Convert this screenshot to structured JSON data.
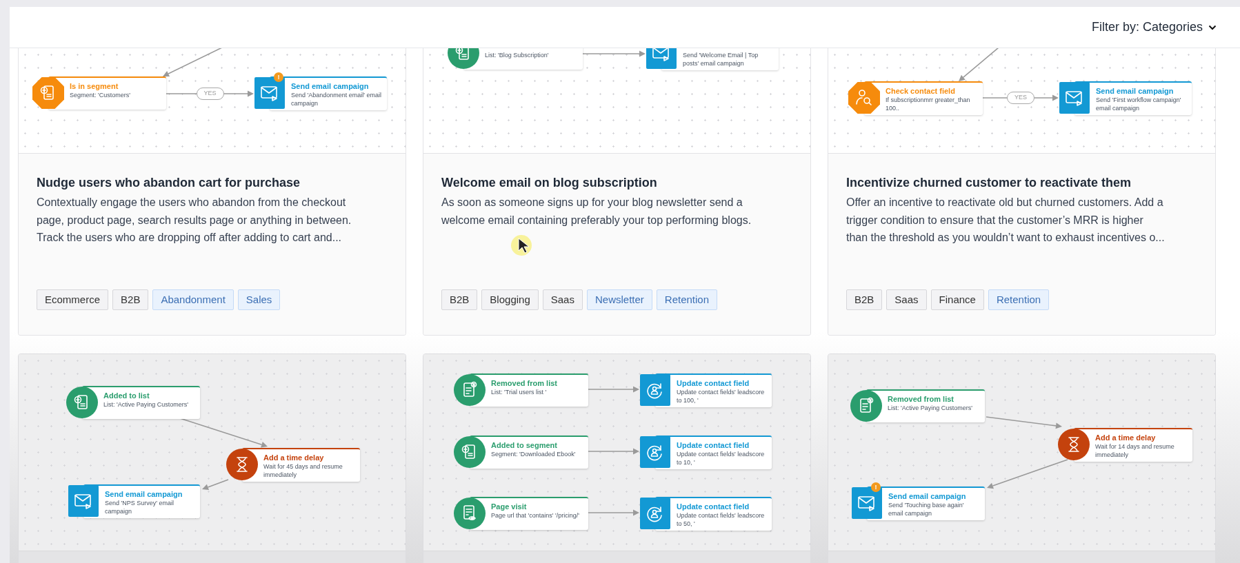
{
  "filter": {
    "label": "Filter by: Categories"
  },
  "templates": [
    {
      "nodes": [
        {
          "kind": "in_segment",
          "title": "Is in segment",
          "description": "Segment: 'Customers'"
        },
        {
          "kind": "send_email",
          "title": "Send email campaign",
          "description": "Send 'Abandonment email' email campaign",
          "badge": "!",
          "branch_label": "YES"
        }
      ],
      "title": "Nudge users who abandon cart for purchase",
      "description": [
        "Contextually engage the users who abandon from the checkout",
        "page, product page, search results page or anything in between.",
        "Track the users who are dropping off after adding to cart and..."
      ],
      "tags": [
        {
          "label": "Ecommerce",
          "kind": "plain"
        },
        {
          "label": "B2B",
          "kind": "plain"
        },
        {
          "label": "Abandonment",
          "kind": "accent"
        },
        {
          "label": "Sales",
          "kind": "accent"
        }
      ]
    },
    {
      "nodes": [
        {
          "kind": "added_to_list",
          "description": "List: 'Blog Subscription'"
        },
        {
          "kind": "send_email",
          "description": "Send 'Welcome Email | Top posts' email campaign"
        }
      ],
      "title": "Welcome email on blog subscription",
      "description": [
        "As soon as someone signs up for your blog newsletter send a",
        "welcome email containing preferably your top performing blogs."
      ],
      "tags": [
        {
          "label": "B2B",
          "kind": "plain"
        },
        {
          "label": "Blogging",
          "kind": "plain"
        },
        {
          "label": "Saas",
          "kind": "plain"
        },
        {
          "label": "Newsletter",
          "kind": "accent"
        },
        {
          "label": "Retention",
          "kind": "accent"
        }
      ]
    },
    {
      "nodes": [
        {
          "kind": "check_field",
          "title": "Check contact field",
          "description": "If subscriptionmrr greater_than 100.."
        },
        {
          "kind": "send_email",
          "title": "Send email campaign",
          "description": "Send 'First workflow campaign' email campaign",
          "branch_label": "YES"
        }
      ],
      "title": "Incentivize churned customer to reactivate them",
      "description": [
        "Offer an incentive to reactivate old but churned customers. Add a",
        "trigger condition to ensure that the customer’s MRR is higher",
        "than the threshold as you wouldn’t want to exhaust incentives o..."
      ],
      "tags": [
        {
          "label": "B2B",
          "kind": "plain"
        },
        {
          "label": "Saas",
          "kind": "plain"
        },
        {
          "label": "Finance",
          "kind": "plain"
        },
        {
          "label": "Retention",
          "kind": "accent"
        }
      ]
    },
    {
      "nodes": [
        {
          "kind": "added_to_list",
          "title": "Added to list",
          "description": "List: 'Active Paying Customers'"
        },
        {
          "kind": "time_delay",
          "title": "Add a time delay",
          "description": "Wait for 45 days and resume immediately"
        },
        {
          "kind": "send_email",
          "title": "Send email campaign",
          "description": "Send 'NPS Survey' email campaign"
        }
      ]
    },
    {
      "nodes": [
        {
          "kind": "removed_from_list",
          "title": "Removed from list",
          "description": "List: 'Trial users list '"
        },
        {
          "kind": "update_field",
          "title": "Update contact field",
          "description": "Update contact fields' leadscore to 100, '"
        },
        {
          "kind": "added_to_segment",
          "title": "Added to segment",
          "description": "Segment: 'Downloaded Ebook'"
        },
        {
          "kind": "update_field",
          "title": "Update contact field",
          "description": "Update contact fields' leadscore to 10, '"
        },
        {
          "kind": "page_visit",
          "title": "Page visit",
          "description": "Page url that 'contains' '/pricing/'"
        },
        {
          "kind": "update_field",
          "title": "Update contact field",
          "description": "Update contact fields' leadscore to 50, '"
        }
      ]
    },
    {
      "nodes": [
        {
          "kind": "removed_from_list",
          "title": "Removed from list",
          "description": "List: 'Active Paying Customers'"
        },
        {
          "kind": "time_delay",
          "title": "Add a time delay",
          "description": "Wait for 14 days and resume immediately"
        },
        {
          "kind": "send_email",
          "title": "Send email campaign",
          "description": "Send 'Touching base again' email campaign",
          "badge": "!"
        }
      ]
    }
  ]
}
